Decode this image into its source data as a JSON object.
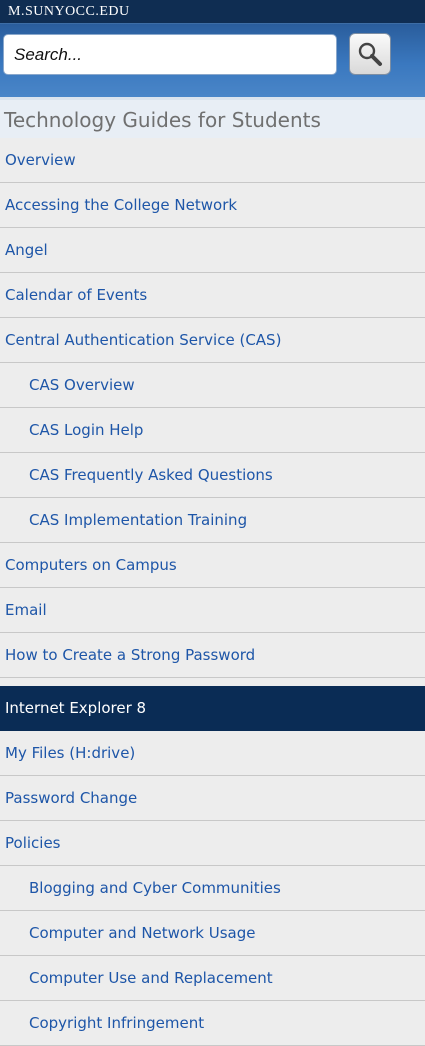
{
  "header": {
    "site_name": "M.SUNYOCC.EDU"
  },
  "search": {
    "placeholder": "Search..."
  },
  "page": {
    "title": "Technology Guides for Students"
  },
  "nav": {
    "items": [
      {
        "label": "Overview",
        "level": 0
      },
      {
        "label": "Accessing the College Network",
        "level": 0
      },
      {
        "label": "Angel",
        "level": 0
      },
      {
        "label": "Calendar of Events",
        "level": 0
      },
      {
        "label": "Central Authentication Service (CAS)",
        "level": 0
      },
      {
        "label": "CAS Overview",
        "level": 1
      },
      {
        "label": "CAS Login Help",
        "level": 1
      },
      {
        "label": "CAS Frequently Asked Questions",
        "level": 1
      },
      {
        "label": "CAS Implementation Training",
        "level": 1
      },
      {
        "label": "Computers on Campus",
        "level": 0
      },
      {
        "label": "Email",
        "level": 0
      },
      {
        "label": "How to Create a Strong Password",
        "level": 0
      },
      {
        "label": "Internet Explorer 8",
        "level": 0,
        "active": true
      },
      {
        "label": "My Files (H:drive)",
        "level": 0
      },
      {
        "label": "Password Change",
        "level": 0
      },
      {
        "label": "Policies",
        "level": 0
      },
      {
        "label": "Blogging and Cyber Communities",
        "level": 1
      },
      {
        "label": "Computer and Network Usage",
        "level": 1
      },
      {
        "label": "Computer Use and Replacement",
        "level": 1
      },
      {
        "label": "Copyright Infringement",
        "level": 1
      }
    ]
  },
  "colors": {
    "header_bg": "#0f2d52",
    "link": "#1e56a8",
    "active_bg": "#0a2c55",
    "list_bg": "#ededed"
  },
  "icons": {
    "search_button": "magnifier-icon"
  }
}
